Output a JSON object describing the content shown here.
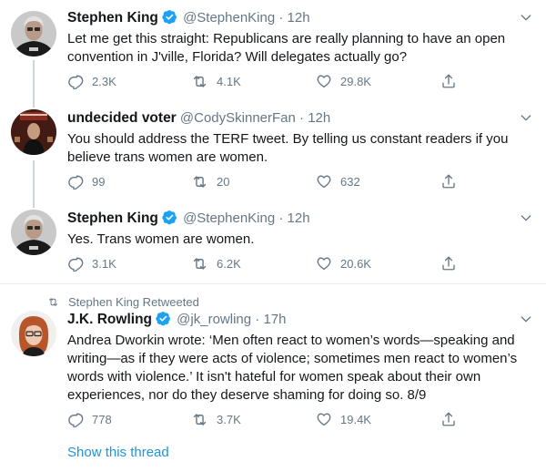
{
  "tweets": [
    {
      "name": "Stephen King",
      "handle": "@StephenKing",
      "time": "12h",
      "lines": [
        "Let me get this straight: Republicans are really planning to have an open",
        "convention in J'ville, Florida? Will delegates actually go?"
      ],
      "replies": "2.3K",
      "retweets": "4.1K",
      "likes": "29.8K"
    },
    {
      "name": "undecided voter",
      "handle": "@CodySkinnerFan",
      "time": "12h",
      "lines": [
        "You should address the TERF tweet. By telling us constant readers if you",
        "believe trans women are women."
      ],
      "replies": "99",
      "retweets": "20",
      "likes": "632"
    },
    {
      "name": "Stephen King",
      "handle": "@StephenKing",
      "time": "12h",
      "lines": [
        "Yes. Trans women are women."
      ],
      "replies": "3.1K",
      "retweets": "6.2K",
      "likes": "20.6K"
    },
    {
      "retweeted_by": "Stephen King Retweeted",
      "name": "J.K. Rowling",
      "handle": "@jk_rowling",
      "time": "17h",
      "lines": [
        "Andrea Dworkin wrote: ‘Men often react to women’s words—speaking and",
        "writing—as if they were acts of violence; sometimes men react to women’s",
        "words with violence.’ It isn't hateful for women speak about their own",
        "experiences, nor do they deserve shaming for doing so. 8/9"
      ],
      "replies": "778",
      "retweets": "3.7K",
      "likes": "19.4K",
      "show_thread": "Show this thread"
    }
  ],
  "separator_dot": "·",
  "colors": {
    "verified": "#1da1f2",
    "muted": "#657786",
    "link": "#1b95e0",
    "text": "#14171a",
    "thread_line": "#ccd6dd"
  },
  "icons": [
    "reply-icon",
    "retweet-icon",
    "like-icon",
    "share-icon",
    "verified-badge-icon",
    "chevron-down-icon"
  ]
}
